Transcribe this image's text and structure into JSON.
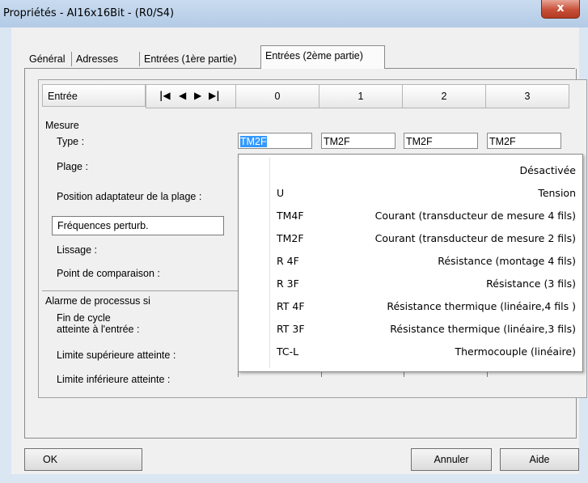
{
  "window": {
    "title": "Propriétés - AI16x16Bit - (R0/S4)",
    "close_glyph": "x"
  },
  "tabs": [
    {
      "label": "Général"
    },
    {
      "label": "Adresses"
    },
    {
      "label": "Entrées (1ère partie)"
    },
    {
      "label": "Entrées (2ème partie)",
      "active": true
    }
  ],
  "header": {
    "entry_label": "Entrée",
    "nav": [
      "|◀",
      "◀",
      "▶",
      "▶|"
    ],
    "channels": [
      "0",
      "1",
      "2",
      "3"
    ]
  },
  "labels": {
    "mesure": "Mesure",
    "type": "Type :",
    "plage": "Plage :",
    "position": "Position adaptateur de la plage :",
    "lissage": "Lissage :",
    "comparaison": "Point de comparaison :",
    "alarme": "Alarme de processus si",
    "fin_cycle_1": "Fin de cycle",
    "fin_cycle_2": "atteinte à l'entrée :",
    "limite_sup": "Limite supérieure atteinte :",
    "limite_inf": "Limite inférieure atteinte :"
  },
  "type_values": [
    "TM2F",
    "TM2F",
    "TM2F",
    "TM2F"
  ],
  "freq_field": {
    "value": "Fréquences perturb."
  },
  "dropdown": [
    {
      "code": "",
      "desc": "Désactivée"
    },
    {
      "code": "U",
      "desc": "Tension"
    },
    {
      "code": "TM4F",
      "desc": "Courant (transducteur de mesure 4 fils)"
    },
    {
      "code": "TM2F",
      "desc": "Courant (transducteur de mesure 2 fils)"
    },
    {
      "code": "R 4F",
      "desc": "Résistance (montage 4 fils)"
    },
    {
      "code": "R 3F",
      "desc": "Résistance (3 fils)"
    },
    {
      "code": "RT 4F",
      "desc": "Résistance thermique (linéaire,4 fils )"
    },
    {
      "code": "RT 3F",
      "desc": "Résistance thermique (linéaire,3 fils)"
    },
    {
      "code": "TC-L",
      "desc": "Thermocouple (linéaire)"
    }
  ],
  "buttons": {
    "ok": "OK",
    "cancel": "Annuler",
    "help": "Aide"
  }
}
